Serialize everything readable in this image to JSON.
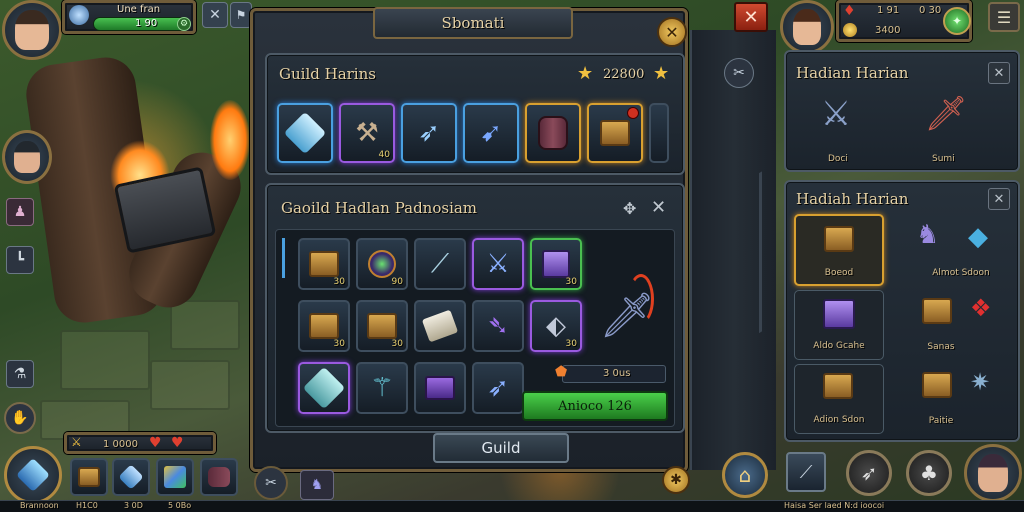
{
  "colors": {
    "accent_gold": "#d8a030",
    "rare_blue": "#4aa0e0",
    "epic_purple": "#9a5ae0",
    "uncommon_green": "#4ac050",
    "action_green": "#3aa03a",
    "close_red": "#c0392b"
  },
  "top_left": {
    "player_name": "Une fran",
    "hp_value": "1 90",
    "gold_text": "1 0000"
  },
  "main_window": {
    "title": "Sbomati"
  },
  "guild_harins": {
    "title": "Guild Harins",
    "star_count": "22800",
    "slots": [
      {
        "icon": "ice-crystal-icon",
        "rarity": "blue",
        "count": ""
      },
      {
        "icon": "hammer-icon",
        "rarity": "purple",
        "count": "40"
      },
      {
        "icon": "spear-icon",
        "rarity": "blue",
        "count": ""
      },
      {
        "icon": "arrow-icon",
        "rarity": "blue",
        "count": ""
      },
      {
        "icon": "barrel-icon",
        "rarity": "gold",
        "count": ""
      },
      {
        "icon": "gold-box-icon",
        "rarity": "gold",
        "count": ""
      }
    ]
  },
  "guild_hadian": {
    "title": "Gaoild Hadlan Padnosiam",
    "grid": [
      {
        "icon": "chest-icon",
        "count": "30"
      },
      {
        "icon": "eye-amulet-icon",
        "count": "90"
      },
      {
        "icon": "blade-icon",
        "count": ""
      },
      {
        "icon": "sword-icon",
        "count": ""
      },
      {
        "icon": "purple-cube-icon",
        "count": "30"
      },
      {
        "icon": "chest-icon",
        "count": "30"
      },
      {
        "icon": "chest-icon",
        "count": "30"
      },
      {
        "icon": "scroll-icon",
        "count": ""
      },
      {
        "icon": "dagger-icon",
        "count": ""
      },
      {
        "icon": "drill-icon",
        "count": "30"
      },
      {
        "icon": "crystal-icon",
        "count": ""
      },
      {
        "icon": "staff-icon",
        "count": ""
      },
      {
        "icon": "purple-chest-icon",
        "count": ""
      },
      {
        "icon": "arrow-icon",
        "count": ""
      }
    ],
    "price": "3 0us",
    "action_label": "Anioco 126"
  },
  "guild_button": "Guild",
  "right_panel": {
    "res_top": "1 91",
    "res_top2": "0 30",
    "res_gold": "3400",
    "section1": {
      "title": "Hadian Harian",
      "heroes": [
        {
          "name": "Doci"
        },
        {
          "name": "Sumi"
        }
      ]
    },
    "section2": {
      "title": "Hadiah Harian",
      "rewards": [
        {
          "label": "Boeod",
          "icon": "gold-chest-icon",
          "selected": true
        },
        {
          "label": "Almot Sdoon",
          "icon": "mage-hero-icon"
        },
        {
          "label": "Aldo Gcahe",
          "icon": "purple-chest-icon"
        },
        {
          "label": "Sanas",
          "icon": "treasure-chest-icon"
        },
        {
          "label": "Adion Sdon",
          "icon": "bronze-chest-icon"
        },
        {
          "label": "Paitie",
          "icon": "crystal-cluster-icon"
        }
      ]
    }
  },
  "bottom_bar": {
    "gold": "1 0000",
    "items_text": [
      "Brannoon",
      "H1C0",
      "3 0D",
      "5 0Bo"
    ],
    "right_text": "Haisa Ser laed N:d ioocoi"
  }
}
